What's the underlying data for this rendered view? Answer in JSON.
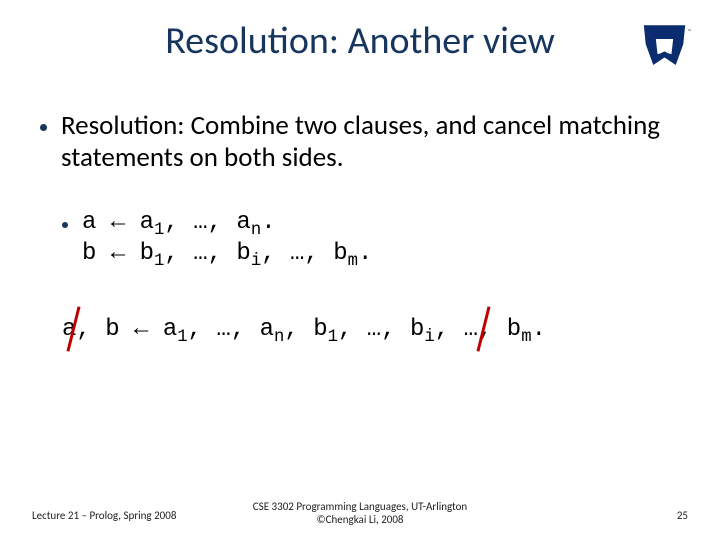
{
  "title": "Resolution: Another view",
  "bullet1": "Resolution: Combine two clauses, and cancel matching statements on both sides.",
  "code": {
    "a_head": "a ",
    "arrow": "←",
    "a_pre": " a",
    "sep1": ", …, a",
    "a_end": ".",
    "b_head": "b ",
    "b_pre": " b",
    "b_mid1": ", …, b",
    "b_mid2": ", …, b",
    "b_end": "."
  },
  "result": {
    "lhs": "a, b ",
    "arrow": "←",
    "a_pre": " a",
    "sep": ", …, a",
    "mid": ", b",
    "sep2": ", …, b",
    "sep3": ", …, b",
    "end": "."
  },
  "sub": {
    "one": "1",
    "n": "n",
    "i": "i",
    "m": "m"
  },
  "footer": {
    "left": "Lecture 21 – Prolog, Spring 2008",
    "center1": "CSE 3302 Programming Languages, UT-Arlington",
    "center2": "©Chengkai Li, 2008",
    "page": "25"
  }
}
